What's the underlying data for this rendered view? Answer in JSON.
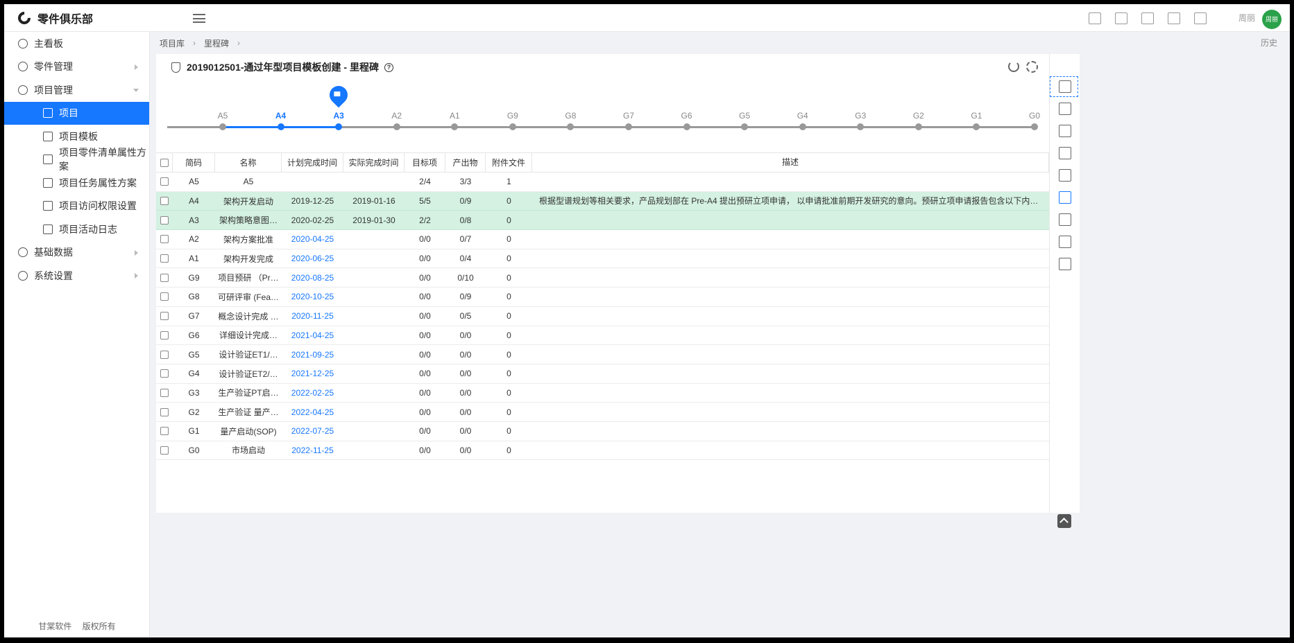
{
  "app": {
    "name": "零件俱乐部",
    "user": "周丽",
    "avatar_text": "周丽",
    "footer": [
      "甘棠软件",
      "版权所有"
    ]
  },
  "sidebar": {
    "items": [
      {
        "label": "主看板",
        "level": 1,
        "expandable": false
      },
      {
        "label": "零件管理",
        "level": 1,
        "expandable": true,
        "expanded": false
      },
      {
        "label": "项目管理",
        "level": 1,
        "expandable": true,
        "expanded": true
      },
      {
        "label": "项目",
        "level": 2,
        "active": true
      },
      {
        "label": "项目模板",
        "level": 2
      },
      {
        "label": "项目零件清单属性方案",
        "level": 2
      },
      {
        "label": "项目任务属性方案",
        "level": 2
      },
      {
        "label": "项目访问权限设置",
        "level": 2
      },
      {
        "label": "项目活动日志",
        "level": 2
      },
      {
        "label": "基础数据",
        "level": 1,
        "expandable": true,
        "expanded": false
      },
      {
        "label": "系统设置",
        "level": 1,
        "expandable": true,
        "expanded": false
      }
    ]
  },
  "breadcrumb": {
    "items": [
      "项目库",
      "里程碑"
    ],
    "history_label": "历史"
  },
  "panel": {
    "title": "2019012501-通过年型项目模板创建 - 里程碑",
    "help": "?"
  },
  "timeline": {
    "milestones": [
      "A5",
      "A4",
      "A3",
      "A2",
      "A1",
      "G9",
      "G8",
      "G7",
      "G6",
      "G5",
      "G4",
      "G3",
      "G2",
      "G1",
      "G0"
    ],
    "reached": [
      "A4",
      "A3"
    ],
    "current": "A3",
    "colors": {
      "reached": "#1677ff",
      "pending": "#999999"
    }
  },
  "table": {
    "headers": [
      "简码",
      "名称",
      "计划完成时间",
      "实际完成时间",
      "目标项",
      "产出物",
      "附件文件",
      "描述"
    ],
    "rows": [
      {
        "code": "A5",
        "name": "A5",
        "plan": "",
        "actual": "",
        "target": "2/4",
        "output": "3/3",
        "attach": "1",
        "desc": "",
        "done": false,
        "future": false
      },
      {
        "code": "A4",
        "name": "架构开发启动",
        "plan": "2019-12-25",
        "actual": "2019-01-16",
        "target": "5/5",
        "output": "0/9",
        "attach": "0",
        "desc": "根据型谱规划等相关要求，产品规划部在 Pre-A4 提出预研立项申请， 以申请批准前期开发研究的意向。预研立项申请报告包含以下内容：立项 需求…",
        "done": true,
        "future": false
      },
      {
        "code": "A3",
        "name": "架构策略意图…",
        "plan": "2020-02-25",
        "actual": "2019-01-30",
        "target": "2/2",
        "output": "0/8",
        "attach": "0",
        "desc": "",
        "done": true,
        "future": false
      },
      {
        "code": "A2",
        "name": "架构方案批准",
        "plan": "2020-04-25",
        "actual": "",
        "target": "0/0",
        "output": "0/7",
        "attach": "0",
        "desc": "",
        "done": false,
        "future": true
      },
      {
        "code": "A1",
        "name": "架构开发完成",
        "plan": "2020-06-25",
        "actual": "",
        "target": "0/0",
        "output": "0/4",
        "attach": "0",
        "desc": "",
        "done": false,
        "future": true
      },
      {
        "code": "G9",
        "name": "项目预研 （Pr…",
        "plan": "2020-08-25",
        "actual": "",
        "target": "0/0",
        "output": "0/10",
        "attach": "0",
        "desc": "",
        "done": false,
        "future": true
      },
      {
        "code": "G8",
        "name": "可研评审 (Fea…",
        "plan": "2020-10-25",
        "actual": "",
        "target": "0/0",
        "output": "0/9",
        "attach": "0",
        "desc": "",
        "done": false,
        "future": true
      },
      {
        "code": "G7",
        "name": "概念设计完成 …",
        "plan": "2020-11-25",
        "actual": "",
        "target": "0/0",
        "output": "0/5",
        "attach": "0",
        "desc": "",
        "done": false,
        "future": true
      },
      {
        "code": "G6",
        "name": "详细设计完成…",
        "plan": "2021-04-25",
        "actual": "",
        "target": "0/0",
        "output": "0/0",
        "attach": "0",
        "desc": "",
        "done": false,
        "future": true
      },
      {
        "code": "G5",
        "name": "设计验证ET1/…",
        "plan": "2021-09-25",
        "actual": "",
        "target": "0/0",
        "output": "0/0",
        "attach": "0",
        "desc": "",
        "done": false,
        "future": true
      },
      {
        "code": "G4",
        "name": "设计验证ET2/…",
        "plan": "2021-12-25",
        "actual": "",
        "target": "0/0",
        "output": "0/0",
        "attach": "0",
        "desc": "",
        "done": false,
        "future": true
      },
      {
        "code": "G3",
        "name": "生产验证PT启…",
        "plan": "2022-02-25",
        "actual": "",
        "target": "0/0",
        "output": "0/0",
        "attach": "0",
        "desc": "",
        "done": false,
        "future": true
      },
      {
        "code": "G2",
        "name": "生产验证 量产…",
        "plan": "2022-04-25",
        "actual": "",
        "target": "0/0",
        "output": "0/0",
        "attach": "0",
        "desc": "",
        "done": false,
        "future": true
      },
      {
        "code": "G1",
        "name": "量产启动(SOP)",
        "plan": "2022-07-25",
        "actual": "",
        "target": "0/0",
        "output": "0/0",
        "attach": "0",
        "desc": "",
        "done": false,
        "future": true
      },
      {
        "code": "G0",
        "name": "市场启动",
        "plan": "2022-11-25",
        "actual": "",
        "target": "0/0",
        "output": "0/0",
        "attach": "0",
        "desc": "",
        "done": false,
        "future": true
      }
    ]
  },
  "right_rail": {
    "icons": [
      "overview-icon",
      "settings-list-icon",
      "checklist-icon",
      "grid-icon",
      "members-icon",
      "milestone-flag-icon",
      "cube-icon",
      "document-icon",
      "calendar-icon"
    ],
    "active": "milestone-flag-icon"
  },
  "colors": {
    "accent": "#1677ff",
    "done_row": "#d4f1e2",
    "avatar": "#2ba14a"
  }
}
